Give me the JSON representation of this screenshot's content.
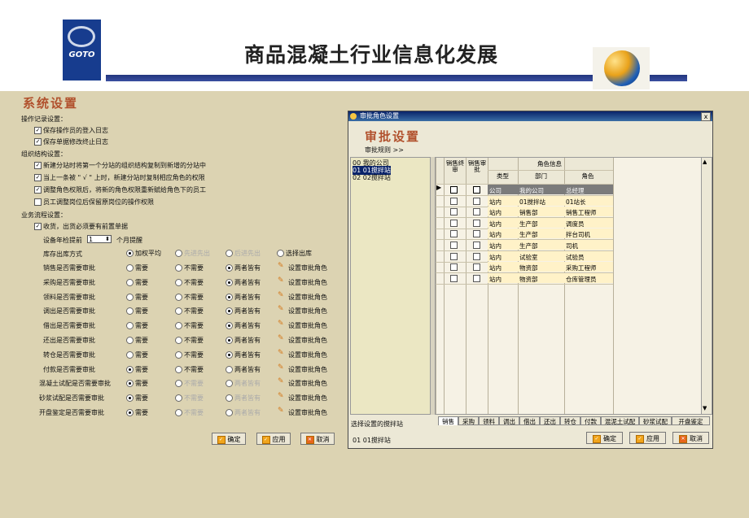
{
  "header": {
    "logo_text": "GOTO",
    "title": "商品混凝土行业信息化发展"
  },
  "left": {
    "title": "系统设置",
    "section_log": "操作记录设置：",
    "log_items": [
      "保存操作员的登入日志",
      "保存单据修改终止日志"
    ],
    "section_org": "组织结构设置：",
    "org_items": [
      "新建分站时将第一个分站的组织结构复制到新增的分站中",
      "当上一条被 \" √ \" 上时，新建分站时复制相应角色的权限",
      "调整角色权限后，将新的角色权限重新赋给角色下的员工",
      "员工调整岗位后保留原岗位的操作权限"
    ],
    "org_checked": [
      true,
      true,
      true,
      false
    ],
    "section_flow": "业务流程设置：",
    "flow_check": "收货，出货必须要有前置单据",
    "reminder_pre": "设备年检提前",
    "reminder_val": "1",
    "reminder_post": "个月提醒",
    "stock_label": "库存出库方式",
    "stock_opts": [
      "加权平均",
      "先进先出",
      "后进先出",
      "选择出库"
    ],
    "rows": [
      {
        "label": "销售是否需要审批",
        "sel": 2,
        "dis": false
      },
      {
        "label": "采购是否需要审批",
        "sel": 2,
        "dis": false
      },
      {
        "label": "领料是否需要审批",
        "sel": 2,
        "dis": false
      },
      {
        "label": "调出是否需要审批",
        "sel": 2,
        "dis": false
      },
      {
        "label": "借出是否需要审批",
        "sel": 2,
        "dis": false
      },
      {
        "label": "还出是否需要审批",
        "sel": 2,
        "dis": false
      },
      {
        "label": "转仓是否需要审批",
        "sel": 2,
        "dis": false
      },
      {
        "label": "付款是否需要审批",
        "sel": 0,
        "dis": false
      },
      {
        "label": "混凝土试配是否需要审批",
        "sel": 0,
        "dis": true
      },
      {
        "label": "砂浆试配是否需要审批",
        "sel": 0,
        "dis": true
      },
      {
        "label": "开盘鉴定是否需要审批",
        "sel": 0,
        "dis": true
      }
    ],
    "opt_need": "需要",
    "opt_noneed": "不需要",
    "opt_both": "两者皆有",
    "set_role": "设置审批角色",
    "btn_ok": "确定",
    "btn_apply": "应用",
    "btn_cancel": "取消"
  },
  "dialog": {
    "title": "审批角色设置",
    "close": "x",
    "heading": "审批设置",
    "rules": "审批规则 >>",
    "stations": [
      "00  我的公司",
      "01  01搅拌站",
      "02  02搅拌站"
    ],
    "station_caption": "选择设置的搅拌站",
    "station_selected": "01  01搅拌站",
    "col_sale_final": "销售终审",
    "col_sale_approve": "销售审批",
    "col_role_info": "角色信息",
    "col_type": "类型",
    "col_dept": "部门",
    "col_role": "角色",
    "roles": [
      {
        "type": "公司",
        "dept": "我的公司",
        "role": "总经理"
      },
      {
        "type": "站内",
        "dept": "01搅拌站",
        "role": "01站长"
      },
      {
        "type": "站内",
        "dept": "销售部",
        "role": "销售工程师"
      },
      {
        "type": "站内",
        "dept": "生产部",
        "role": "调度员"
      },
      {
        "type": "站内",
        "dept": "生产部",
        "role": "拌台司机"
      },
      {
        "type": "站内",
        "dept": "生产部",
        "role": "司机"
      },
      {
        "type": "站内",
        "dept": "试验室",
        "role": "试验员"
      },
      {
        "type": "站内",
        "dept": "物资部",
        "role": "采购工程师"
      },
      {
        "type": "站内",
        "dept": "物资部",
        "role": "仓库管理员"
      }
    ],
    "tabs": [
      "销售",
      "采购",
      "领料",
      "调出",
      "借出",
      "还出",
      "转仓",
      "付款",
      "混泥土试配",
      "砂浆试配",
      "开盘鉴定"
    ],
    "btn_ok": "确定",
    "btn_apply": "应用",
    "btn_cancel": "取消"
  },
  "colors": {
    "heading": "#b1512d",
    "titlebar": "#0a246a",
    "body_bg": "#dcd3b2"
  }
}
